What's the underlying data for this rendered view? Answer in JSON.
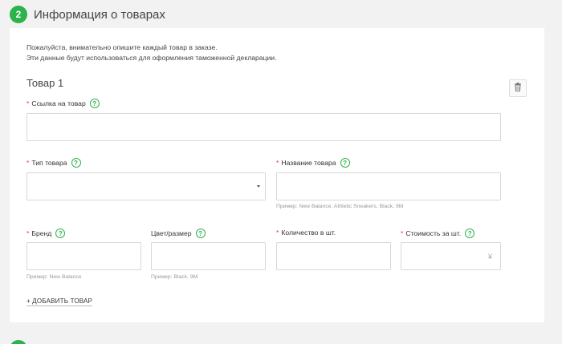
{
  "step": {
    "number": "2",
    "title": "Информация о товарах"
  },
  "intro": {
    "line1": "Пожалуйста, внимательно опишите каждый товар в заказе.",
    "line2": "Эти данные будут использоваться для оформления таможенной декларации."
  },
  "item": {
    "title": "Товар 1",
    "required_mark": "*",
    "help_glyph": "?",
    "link_label": "Ссылка на товар",
    "type_label": "Тип товара",
    "name_label": "Название товара",
    "name_hint": "Пример: New Balance, Athletic Sneakers, Black, 9M",
    "brand_label": "Бренд",
    "brand_hint": "Пример: New Balance",
    "color_label": "Цвет/размер",
    "color_hint": "Пример: Black, 9M",
    "qty_label": "Количество в шт.",
    "price_label": "Стоимость за шт.",
    "currency": "¥"
  },
  "add_item_label": "+ ДОБАВИТЬ ТОВАР",
  "colors": {
    "accent": "#2cb34a",
    "required": "#e53935"
  },
  "icons": {
    "delete": "trash-icon",
    "help": "help-icon",
    "select": "caret-down-icon"
  }
}
